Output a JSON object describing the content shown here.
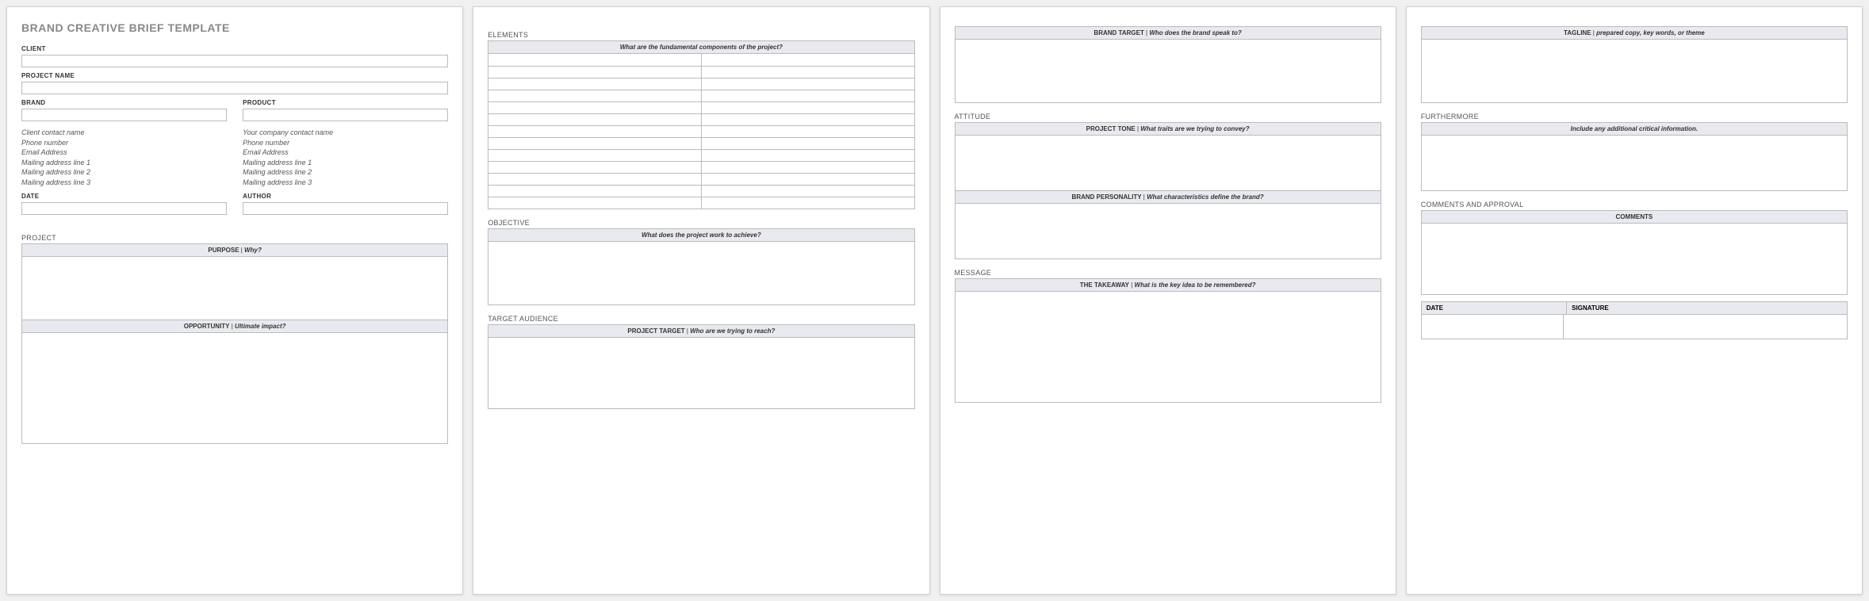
{
  "title": "BRAND CREATIVE BRIEF TEMPLATE",
  "labels": {
    "client": "CLIENT",
    "projectName": "PROJECT NAME",
    "brand": "BRAND",
    "product": "PRODUCT",
    "date": "DATE",
    "author": "AUTHOR"
  },
  "contactLeft": {
    "name": "Client contact name",
    "phone": "Phone number",
    "email": "Email Address",
    "addr1": "Mailing address line 1",
    "addr2": "Mailing address line 2",
    "addr3": "Mailing address line 3"
  },
  "contactRight": {
    "name": "Your company contact name",
    "phone": "Phone number",
    "email": "Email Address",
    "addr1": "Mailing address line 1",
    "addr2": "Mailing address line 2",
    "addr3": "Mailing address line 3"
  },
  "sections": {
    "project": "PROJECT",
    "elements": "ELEMENTS",
    "objective": "OBJECTIVE",
    "targetAudience": "TARGET AUDIENCE",
    "attitude": "ATTITUDE",
    "message": "MESSAGE",
    "furthermore": "FURTHERMORE",
    "commentsApproval": "COMMENTS AND APPROVAL"
  },
  "headers": {
    "purpose": {
      "strong": "PURPOSE",
      "italic": "Why?"
    },
    "opportunity": {
      "strong": "OPPORTUNITY",
      "italic": "Ultimate impact?"
    },
    "elements": {
      "italic": "What are the fundamental components of the project?"
    },
    "objective": {
      "italic": "What does the project work to achieve?"
    },
    "projectTarget": {
      "strong": "PROJECT TARGET",
      "italic": "Who are we trying to reach?"
    },
    "brandTarget": {
      "strong": "BRAND TARGET",
      "italic": "Who does the brand speak to?"
    },
    "projectTone": {
      "strong": "PROJECT TONE",
      "italic": "What traits are we trying to convey?"
    },
    "brandPersonality": {
      "strong": "BRAND PERSONALITY",
      "italic": "What characteristics define the brand?"
    },
    "takeaway": {
      "strong": "THE TAKEAWAY",
      "italic": "What is the key idea to be remembered?"
    },
    "tagline": {
      "strong": "TAGLINE",
      "italic": "prepared copy, key words, or theme"
    },
    "furthermore": {
      "italic": "Include any additional critical information."
    },
    "comments": {
      "strong": "COMMENTS"
    }
  },
  "approval": {
    "date": "DATE",
    "signature": "SIGNATURE"
  },
  "sep": "   |   "
}
